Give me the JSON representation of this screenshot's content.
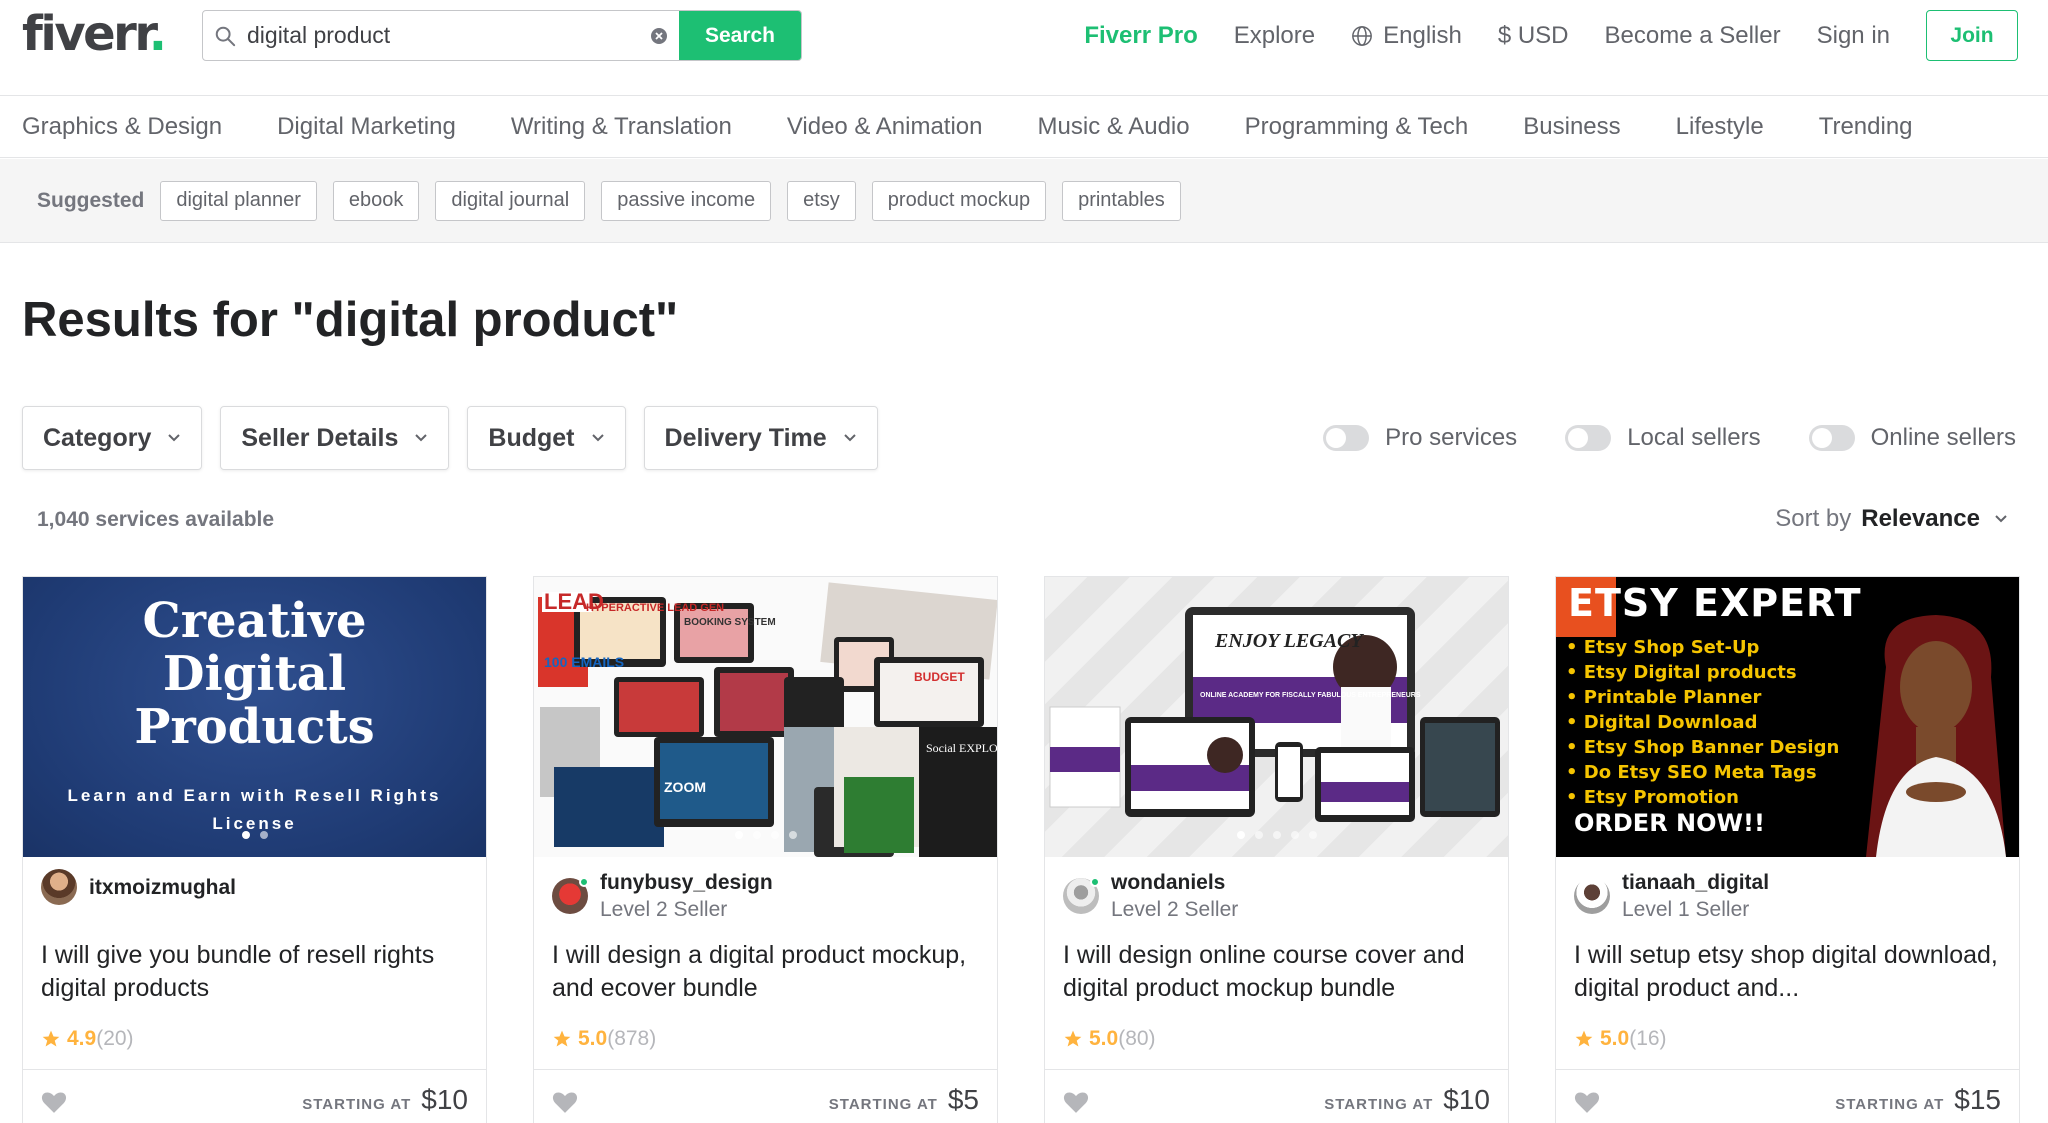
{
  "header": {
    "logo": "fiverr",
    "logo_dot": ".",
    "search_value": "digital product",
    "search_button": "Search",
    "nav": {
      "pro": "Fiverr Pro",
      "explore": "Explore",
      "language": "English",
      "currency": "$ USD",
      "become_seller": "Become a Seller",
      "sign_in": "Sign in",
      "join": "Join"
    }
  },
  "categories": [
    "Graphics & Design",
    "Digital Marketing",
    "Writing & Translation",
    "Video & Animation",
    "Music & Audio",
    "Programming & Tech",
    "Business",
    "Lifestyle",
    "Trending"
  ],
  "suggested": {
    "label": "Suggested",
    "chips": [
      "digital planner",
      "ebook",
      "digital journal",
      "passive income",
      "etsy",
      "product mockup",
      "printables"
    ]
  },
  "results": {
    "title": "Results for \"digital product\"",
    "filters": [
      "Category",
      "Seller Details",
      "Budget",
      "Delivery Time"
    ],
    "toggles": [
      "Pro services",
      "Local sellers",
      "Online sellers"
    ],
    "count": "1,040 services available",
    "sort_label": "Sort by",
    "sort_value": "Relevance"
  },
  "gigs": [
    {
      "seller": "itxmoizmughal",
      "level": "",
      "title": "I will give you bundle of resell rights digital products",
      "rating": "4.9",
      "reviews": "(20)",
      "starting_label": "STARTING AT",
      "price": "$10",
      "img_text": {
        "line1": "Creative",
        "line2": "Digital",
        "line3": "Products",
        "sub": "Learn and Earn with Resell Rights License"
      }
    },
    {
      "seller": "funybusy_design",
      "level": "Level 2 Seller",
      "title": "I will design a digital product mockup, and ecover bundle",
      "rating": "5.0",
      "reviews": "(878)",
      "starting_label": "STARTING AT",
      "price": "$5",
      "img_text": {
        "lead": "LEAD",
        "gen": "HYPERACTIVE LEAD GEN",
        "booking": "BOOKING SYSTEM",
        "emails": "100 EMAILS",
        "budget": "BUDGET",
        "zoom": "ZOOM",
        "social": "Social EXPLOSION"
      }
    },
    {
      "seller": "wondaniels",
      "level": "Level 2 Seller",
      "title": "I will design online course cover and digital product mockup bundle",
      "rating": "5.0",
      "reviews": "(80)",
      "starting_label": "STARTING AT",
      "price": "$10",
      "img_text": {
        "brand": "ENJOY LEGACY",
        "academy": "ONLINE ACADEMY FOR FISCALLY FABULOUS ENTREPRENEURS"
      }
    },
    {
      "seller": "tianaah_digital",
      "level": "Level 1 Seller",
      "title": "I will setup etsy shop digital download, digital product and...",
      "rating": "5.0",
      "reviews": "(16)",
      "starting_label": "STARTING AT",
      "price": "$15",
      "img_text": {
        "headline": "ETSY EXPERT",
        "bullets": [
          "Etsy Shop Set-Up",
          "Etsy Digital products",
          "Printable Planner",
          "Digital Download",
          "Etsy Shop Banner Design",
          "Do Etsy SEO Meta Tags",
          "Etsy Promotion"
        ],
        "cta": "ORDER NOW!!"
      }
    }
  ],
  "colors": {
    "brand": "#1dbf73",
    "star": "#ffb33e",
    "text": "#404145"
  }
}
